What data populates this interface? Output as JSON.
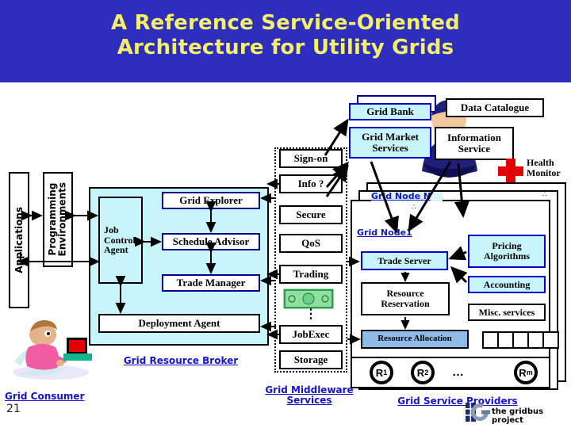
{
  "slide": {
    "title_line1": "A Reference Service-Oriented",
    "title_line2": "Architecture for Utility Grids",
    "page_number": "21",
    "brand_text": "the gridbus project",
    "banner_bg": "#2d2dbe",
    "title_color": "#f5f06a"
  },
  "consumer": {
    "applications_label": "Applications",
    "programming_label": "Programming\nEnvironments",
    "caption": "Grid Consumer"
  },
  "broker": {
    "caption": "Grid Resource Broker",
    "job_control_agent": "Job\nControl\nAgent",
    "grid_explorer": "Grid Explorer",
    "schedule_advisor": "Schedule Advisor",
    "trade_manager": "Trade Manager",
    "deployment_agent": "Deployment Agent"
  },
  "middleware": {
    "caption_line1": "Grid Middleware",
    "caption_line2": "Services",
    "services": [
      "Sign-on",
      "Info ?",
      "Secure",
      "QoS",
      "Trading",
      "JobExec",
      "Storage"
    ],
    "vertical_ellipsis": "⋮"
  },
  "market": {
    "grid_bank": "Grid Bank",
    "grid_market_services": "Grid Market\nServices",
    "data_catalogue": "Data Catalogue",
    "information_service": "Information\nService",
    "health_monitor": "Health\nMonitor"
  },
  "providers": {
    "caption": "Grid Service Providers",
    "node_n_label": "Grid Node N",
    "node_1_label": "Grid Node1",
    "trade_server": "Trade Server",
    "resource_reservation": "Resource\nReservation",
    "resource_allocation": "Resource Allocation",
    "pricing_algorithms": "Pricing\nAlgorithms",
    "accounting": "Accounting",
    "misc_services": "Misc. services",
    "resources": [
      "R₁",
      "R₂",
      "Rₘ"
    ],
    "resources_ellipsis": "…"
  },
  "colors": {
    "cyan_fill": "#c8f5fb",
    "blue_border": "#0000c8",
    "steel_fill": "#8fbbe8",
    "link_blue": "#1414c8",
    "red": "#e50000"
  }
}
